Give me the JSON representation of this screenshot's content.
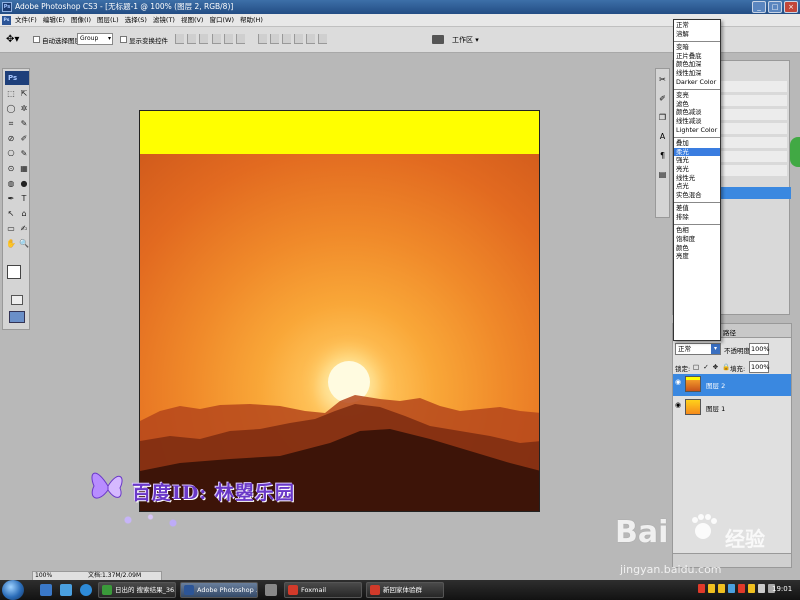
{
  "window": {
    "title": "Adobe Photoshop CS3 - [无标题-1 @ 100% (图层 2, RGB/8)]",
    "ps_badge": "Ps",
    "min": "_",
    "max": "□",
    "close": "×"
  },
  "menu": {
    "items": [
      "文件(F)",
      "编辑(E)",
      "图像(I)",
      "图层(L)",
      "选择(S)",
      "滤镜(T)",
      "视图(V)",
      "窗口(W)",
      "帮助(H)"
    ]
  },
  "options": {
    "auto_select_label": "自动选择图层",
    "auto_select_value": "Group",
    "show_transform_label": "显示变换控件",
    "workspace_label": "工作区 ▾"
  },
  "toolbox": {
    "badge": "Ps",
    "tools": [
      "⬚",
      "⇱",
      "◯",
      "✲",
      "⌗",
      "✎",
      "⊘",
      "✐",
      "⎔",
      "✎",
      "⊙",
      "▦",
      "◍",
      "●",
      "✒",
      "T",
      "↖",
      "⌂",
      "▭",
      "✍",
      "✋",
      "🔍"
    ]
  },
  "canvas": {
    "band_color": "#ffff00"
  },
  "watermark_text": "百度ID: 林曌乐园",
  "blend_menu": {
    "groups": [
      [
        "正常",
        "溶解"
      ],
      [
        "变暗",
        "正片叠底",
        "颜色加深",
        "线性加深",
        "Darker Color"
      ],
      [
        "变亮",
        "滤色",
        "颜色减淡",
        "线性减淡",
        "Lighter Color"
      ],
      [
        "叠加",
        "柔光",
        "强光",
        "亮光",
        "线性光",
        "点光",
        "实色混合"
      ],
      [
        "差值",
        "排除"
      ],
      [
        "色相",
        "饱和度",
        "颜色",
        "亮度"
      ]
    ],
    "selected": "柔光"
  },
  "layers_panel": {
    "tab_label": "路径",
    "blend_mode": "正常",
    "opacity_label": "不透明度:",
    "opacity_value": "100%",
    "lock_label": "锁定:",
    "lock_icons": "□ ✓ ✥ 🔒",
    "fill_label": "填充:",
    "fill_value": "100%",
    "layers": [
      {
        "name": "图层 2",
        "selected": true
      },
      {
        "name": "图层 1",
        "selected": false
      }
    ]
  },
  "status": {
    "zoom": "100%",
    "doc": "文档:1.37M/2.09M"
  },
  "taskbar": {
    "buttons": [
      {
        "label": "日出的 搜索结果_36...",
        "color": "#3a9a3a"
      },
      {
        "label": "Adobe Photoshop ...",
        "color": "#2c5597",
        "active": true
      },
      {
        "label": "Foxmail",
        "color": "#d23a2a"
      },
      {
        "label": "新回家体验群",
        "color": "#d23a2a"
      }
    ],
    "clock": "19:01"
  },
  "baidu": {
    "logo": "Bai",
    "jingyan": "经验",
    "url": "jingyan.baidu.com"
  }
}
